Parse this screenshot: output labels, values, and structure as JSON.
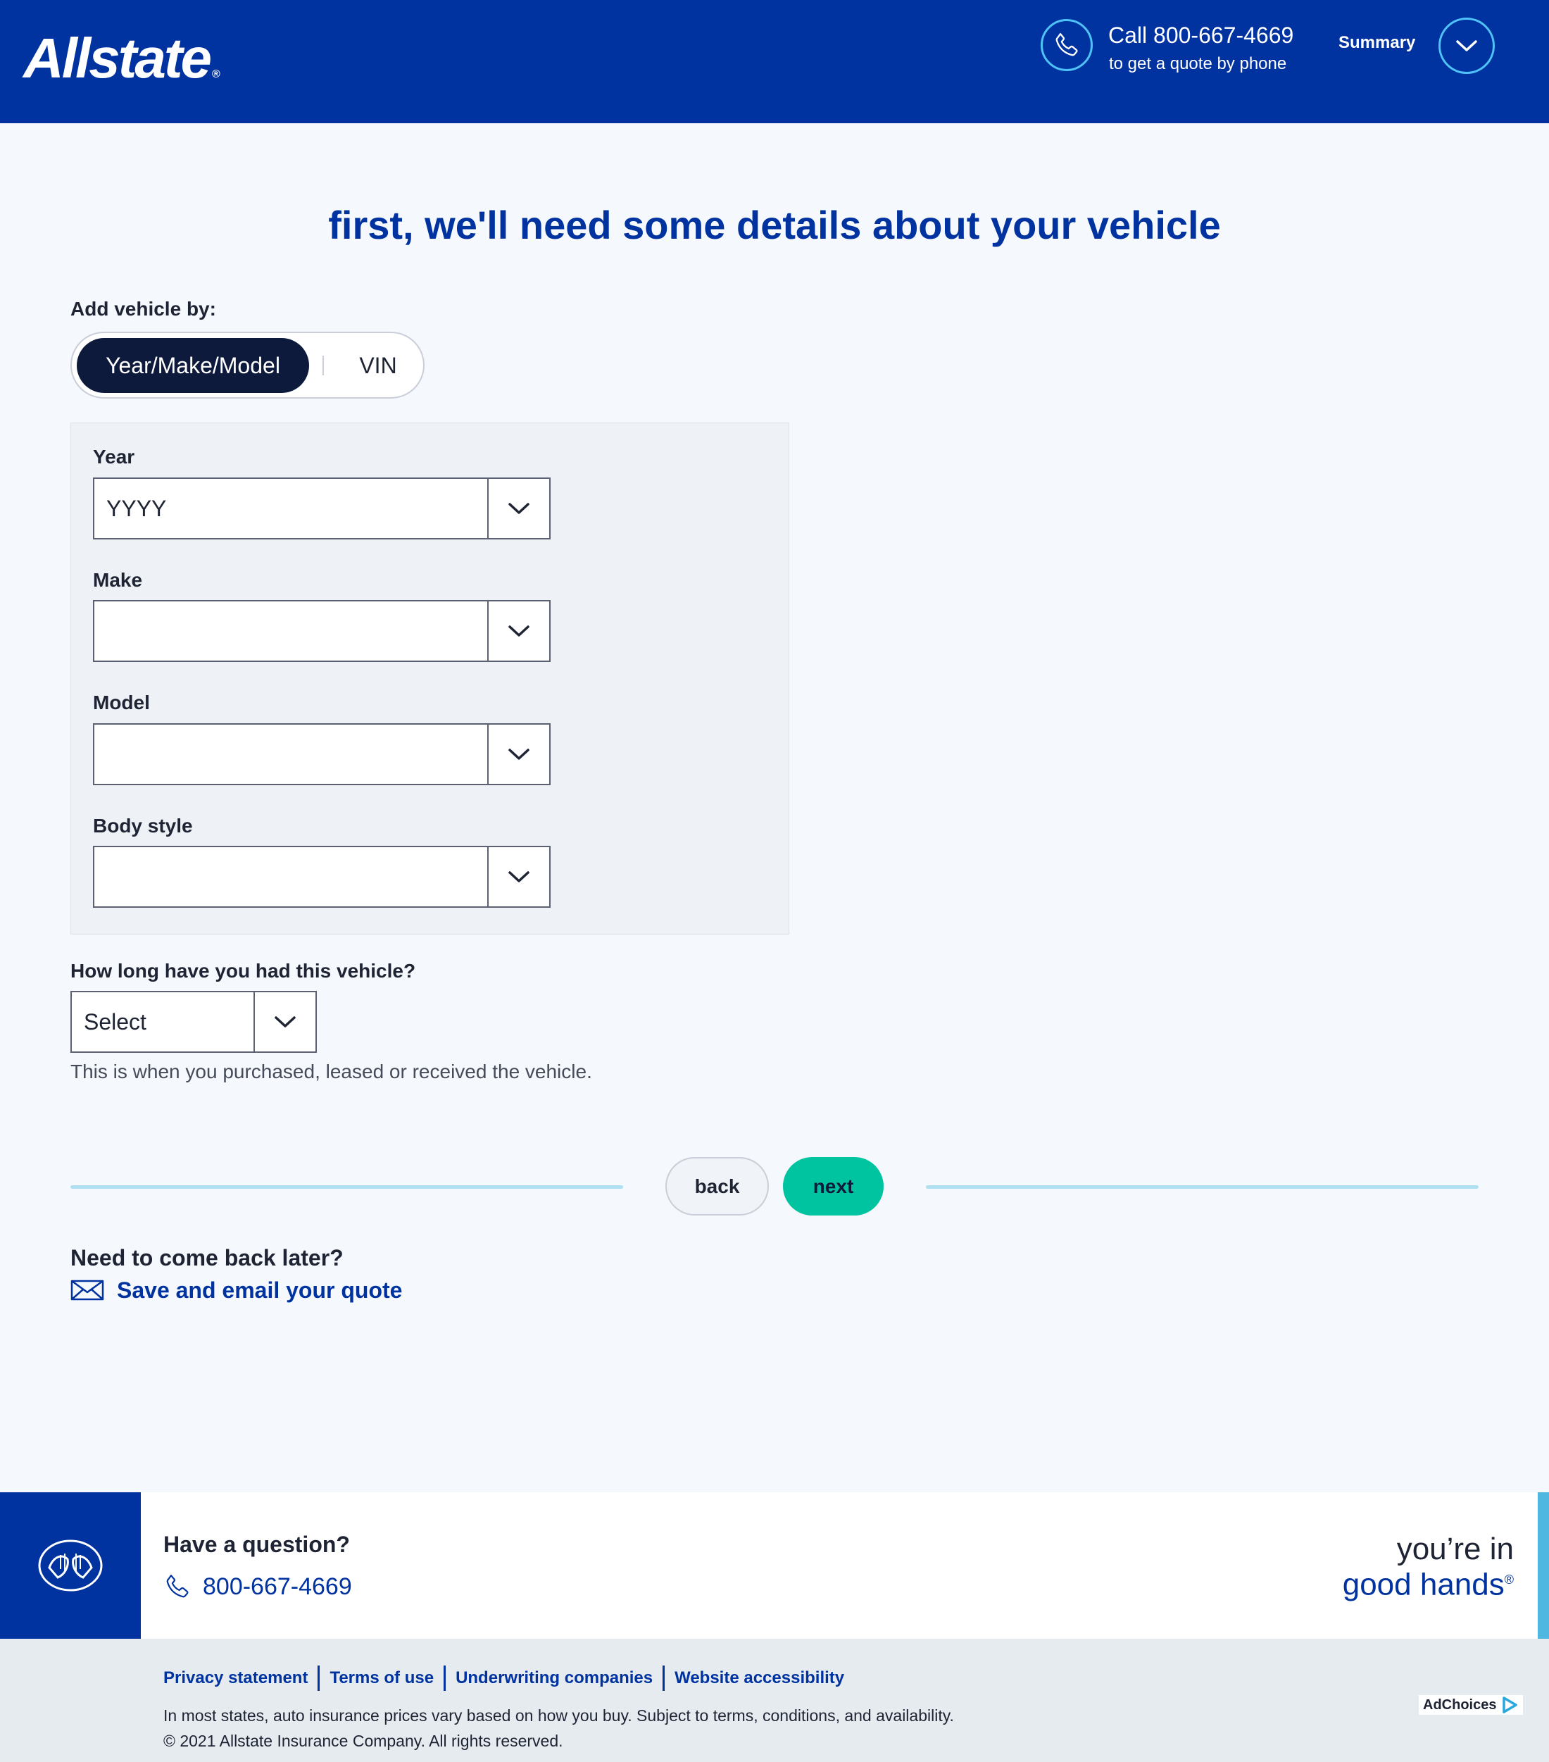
{
  "header": {
    "logo_text": "Allstate",
    "logo_reg": "®",
    "call_title": "Call 800-667-4669",
    "call_subtitle": "to get a quote by phone",
    "summary_label": "Summary"
  },
  "main": {
    "title": "first, we'll need some details about your vehicle",
    "add_vehicle_label": "Add vehicle by:",
    "toggle": {
      "active": "Year/Make/Model",
      "inactive": "VIN"
    },
    "fields": {
      "year": {
        "label": "Year",
        "value": "YYYY"
      },
      "make": {
        "label": "Make",
        "value": ""
      },
      "model": {
        "label": "Model",
        "value": ""
      },
      "body_style": {
        "label": "Body style",
        "value": ""
      }
    },
    "ownership": {
      "label": "How long have you had this vehicle?",
      "value": "Select",
      "hint": "This is when you purchased, leased or received the vehicle."
    },
    "buttons": {
      "back": "back",
      "next": "next"
    },
    "later": {
      "question": "Need to come back later?",
      "link": "Save and email your quote"
    }
  },
  "footer": {
    "question": "Have a question?",
    "phone": "800-667-4669",
    "tagline_line1": "you’re in",
    "tagline_line2": "good hands",
    "tagline_reg": "®",
    "links": [
      "Privacy statement",
      "Terms of use",
      "Underwriting companies",
      "Website accessibility"
    ],
    "legal_line1": "In most states, auto insurance prices vary based on how you buy. Subject to terms, conditions, and availability.",
    "legal_line2": "© 2021 Allstate Insurance Company. All rights reserved.",
    "adchoices": "AdChoices"
  },
  "colors": {
    "brand_blue": "#0033a0",
    "accent_cyan": "#4fc3f7",
    "next_green": "#00c4a0",
    "toggle_dark": "#0e1a3c"
  },
  "icons": [
    "phone-icon",
    "chevron-down-icon",
    "envelope-icon",
    "good-hands-logo-icon",
    "adchoices-icon"
  ]
}
